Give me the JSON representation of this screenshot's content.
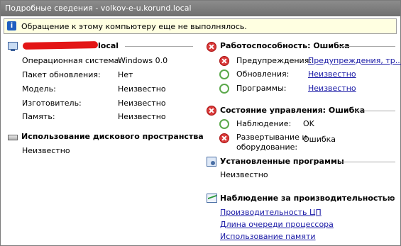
{
  "window": {
    "title": "Подробные сведения - volkov-e-u.korund.local"
  },
  "info": {
    "message": "Обращение к этому компьютеру еще не выполнялось."
  },
  "computer": {
    "name_suffix": "local",
    "rows": [
      {
        "label": "Операционная система:",
        "value": "Windows 0.0"
      },
      {
        "label": "Пакет обновления:",
        "value": "Нет"
      },
      {
        "label": "Модель:",
        "value": "Неизвестно"
      },
      {
        "label": "Изготовитель:",
        "value": "Неизвестно"
      },
      {
        "label": "Память:",
        "value": "Неизвестно"
      }
    ]
  },
  "disk": {
    "title": "Использование дискового пространства",
    "value": "Неизвестно"
  },
  "health": {
    "title": "Работоспособность: Ошибка",
    "items": [
      {
        "label": "Предупреждения:",
        "value": "Предупреждения, тр..."
      },
      {
        "label": "Обновления:",
        "value": "Неизвестно"
      },
      {
        "label": "Программы:",
        "value": "Неизвестно"
      }
    ]
  },
  "management": {
    "title": "Состояние управления: Ошибка",
    "items": [
      {
        "label": "Наблюдение:",
        "value": "OK"
      },
      {
        "label_line1": "Развертывание и",
        "label_line2": "оборудование:",
        "value": "Ошибка"
      }
    ]
  },
  "installed": {
    "title": "Установленные программы",
    "value": "Неизвестно"
  },
  "perf": {
    "title": "Наблюдение за производительностью",
    "links": [
      "Производительность ЦП",
      "Длина очереди процессора",
      "Использование памяти"
    ]
  }
}
